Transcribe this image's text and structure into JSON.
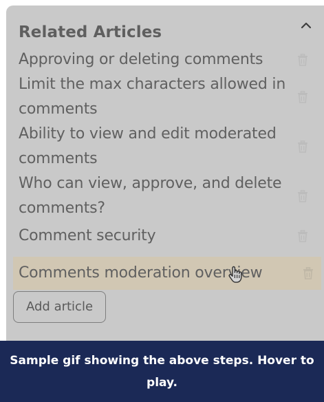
{
  "panel": {
    "title": "Related Articles",
    "collapse_icon": "chevron-up-icon",
    "items": [
      {
        "label": "Approving or deleting comments",
        "icon": "trash-icon"
      },
      {
        "label": "Limit the max characters allowed in comments",
        "icon": "trash-icon"
      },
      {
        "label": "Ability to view and edit moderated comments",
        "icon": "trash-icon"
      },
      {
        "label": "Who can view, approve, and delete comments?",
        "icon": "trash-icon"
      },
      {
        "label": "Comment security",
        "icon": "trash-icon"
      },
      {
        "label": "Comments moderation overview",
        "icon": "trash-icon",
        "highlighted": true
      }
    ],
    "add_button_label": "Add article"
  },
  "caption": {
    "text": "Sample gif showing the above steps. Hover to play."
  },
  "colors": {
    "overlay_panel": "#c9c9c9",
    "highlight_row": "#d1c7b3",
    "caption_bar": "#1b2956",
    "caption_text": "#ffffff",
    "text_muted": "#606060"
  },
  "cursor_icon": "hand-pointer-icon"
}
